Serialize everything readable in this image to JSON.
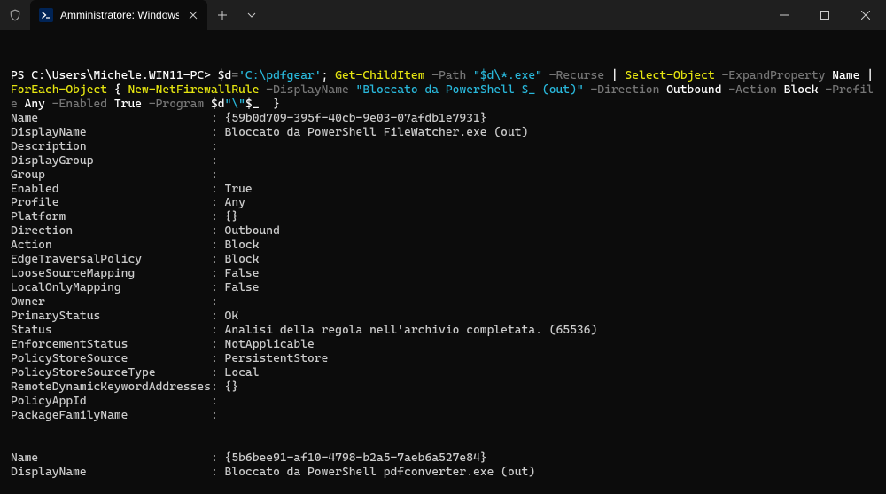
{
  "titlebar": {
    "shield_name": "shield-icon",
    "tab_title": "Amministratore: Windows PowerShell",
    "tab_ps_icon": "powershell-icon",
    "close_tab_icon": "close-icon",
    "new_tab_icon": "plus-icon",
    "dropdown_icon": "chevron-down-icon",
    "minimize_icon": "minimize-icon",
    "maximize_icon": "maximize-icon",
    "window_close_icon": "close-icon"
  },
  "terminal": {
    "prompt": "PS C:\\Users\\Michele.WIN11-PC> ",
    "cmd": {
      "p1": "$d",
      "p2": "=",
      "p3": "'C:\\pdfgear'",
      "p4": "; ",
      "p5": "Get-ChildItem",
      "p6": " -Path ",
      "p7": "\"$d\\*.exe\"",
      "p8": " -Recurse ",
      "p9": "|",
      "p10": " ",
      "p11": "Select-Object",
      "p12": " -ExpandProperty ",
      "p13": "Name",
      "p14": " ",
      "p15": "|",
      "p16": " ",
      "p17": "ForEach-Object",
      "p18": " { ",
      "p19": "New-NetFirewallRule",
      "p20": " -DisplayName ",
      "p21": "\"Bloccato da PowerShell $_ (out)\"",
      "p22": " -Direction ",
      "p23": "Outbound",
      "p24": " -Action ",
      "p25": "Block",
      "p26": " -Profile ",
      "p27": "Any",
      "p28": " -Enabled ",
      "p29": "True",
      "p30": " -Program ",
      "p31": "$d",
      "p32": "\"\\\"",
      "p33": "$_",
      "p34": "  }"
    },
    "rows1": [
      {
        "k": "Name",
        "v": "{59b0d709-395f-40cb-9e03-07afdb1e7931}"
      },
      {
        "k": "DisplayName",
        "v": "Bloccato da PowerShell FileWatcher.exe (out)"
      },
      {
        "k": "Description",
        "v": ""
      },
      {
        "k": "DisplayGroup",
        "v": ""
      },
      {
        "k": "Group",
        "v": ""
      },
      {
        "k": "Enabled",
        "v": "True"
      },
      {
        "k": "Profile",
        "v": "Any"
      },
      {
        "k": "Platform",
        "v": "{}"
      },
      {
        "k": "Direction",
        "v": "Outbound"
      },
      {
        "k": "Action",
        "v": "Block"
      },
      {
        "k": "EdgeTraversalPolicy",
        "v": "Block"
      },
      {
        "k": "LooseSourceMapping",
        "v": "False"
      },
      {
        "k": "LocalOnlyMapping",
        "v": "False"
      },
      {
        "k": "Owner",
        "v": ""
      },
      {
        "k": "PrimaryStatus",
        "v": "OK"
      },
      {
        "k": "Status",
        "v": "Analisi della regola nell'archivio completata. (65536)"
      },
      {
        "k": "EnforcementStatus",
        "v": "NotApplicable"
      },
      {
        "k": "PolicyStoreSource",
        "v": "PersistentStore"
      },
      {
        "k": "PolicyStoreSourceType",
        "v": "Local"
      },
      {
        "k": "RemoteDynamicKeywordAddresses",
        "v": "{}"
      },
      {
        "k": "PolicyAppId",
        "v": ""
      },
      {
        "k": "PackageFamilyName",
        "v": ""
      }
    ],
    "rows2": [
      {
        "k": "Name",
        "v": "{5b6bee91-af10-4798-b2a5-7aeb6a527e84}"
      },
      {
        "k": "DisplayName",
        "v": "Bloccato da PowerShell pdfconverter.exe (out)"
      }
    ]
  }
}
